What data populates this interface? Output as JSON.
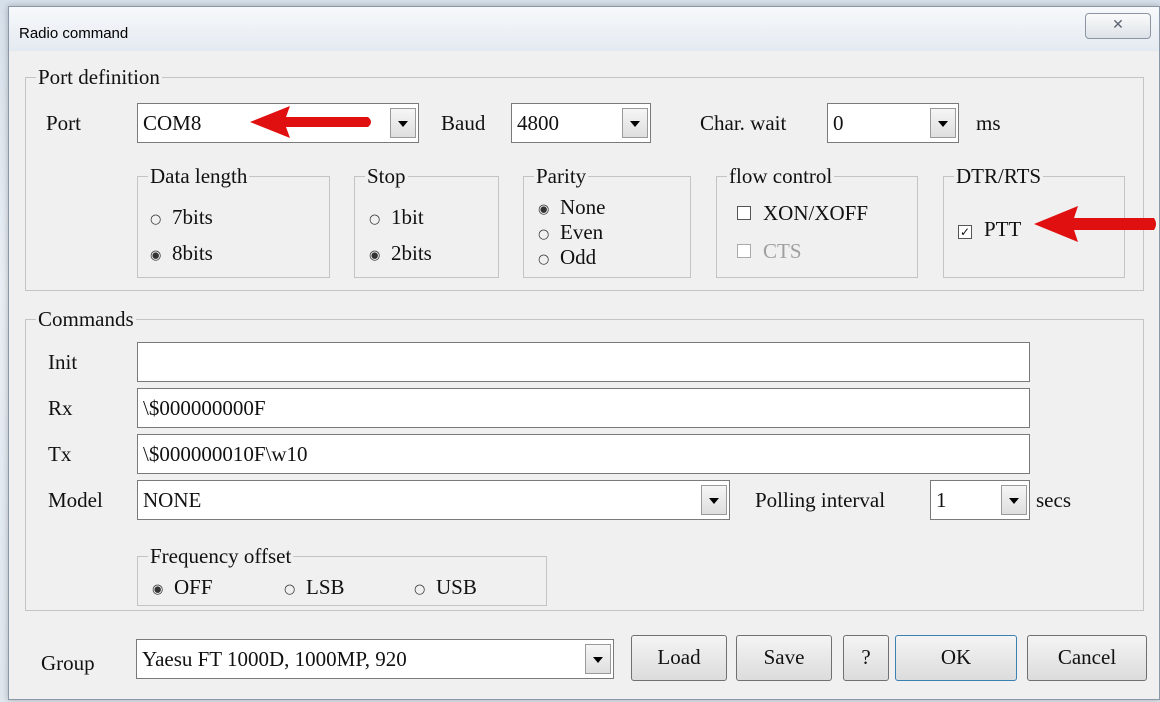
{
  "window": {
    "title": "Radio command",
    "close_glyph": "✕"
  },
  "port_definition": {
    "legend": "Port definition",
    "port": {
      "label": "Port",
      "value": "COM8"
    },
    "baud": {
      "label": "Baud",
      "value": "4800"
    },
    "char_wait": {
      "label": "Char. wait",
      "value": "0",
      "unit": "ms"
    },
    "data_length": {
      "legend": "Data length",
      "options": [
        "7bits",
        "8bits"
      ],
      "selected": "8bits"
    },
    "stop": {
      "legend": "Stop",
      "options": [
        "1bit",
        "2bits"
      ],
      "selected": "2bits"
    },
    "parity": {
      "legend": "Parity",
      "options": [
        "None",
        "Even",
        "Odd"
      ],
      "selected": "None"
    },
    "flow_control": {
      "legend": "flow control",
      "xon_xoff": "XON/XOFF",
      "cts": "CTS"
    },
    "dtr_rts": {
      "legend": "DTR/RTS",
      "ptt": "PTT",
      "ptt_checked": true
    }
  },
  "commands": {
    "legend": "Commands",
    "init": {
      "label": "Init",
      "value": ""
    },
    "rx": {
      "label": "Rx",
      "value": "\\$000000000F"
    },
    "tx": {
      "label": "Tx",
      "value": "\\$000000010F\\w10"
    },
    "model": {
      "label": "Model",
      "value": "NONE"
    },
    "polling": {
      "label": "Polling interval",
      "value": "1",
      "unit": "secs"
    },
    "frequency_offset": {
      "legend": "Frequency offset",
      "options": [
        "OFF",
        "LSB",
        "USB"
      ],
      "selected": "OFF"
    }
  },
  "footer": {
    "group_label": "Group",
    "group_value": "Yaesu FT 1000D, 1000MP, 920",
    "load": "Load",
    "save": "Save",
    "help": "?",
    "ok": "OK",
    "cancel": "Cancel"
  },
  "colors": {
    "annotation_arrow": "#e01010",
    "window_bg": "#f0f0f0"
  },
  "icons": {
    "radio_on": "◉",
    "radio_off": "○",
    "check": "✓"
  }
}
